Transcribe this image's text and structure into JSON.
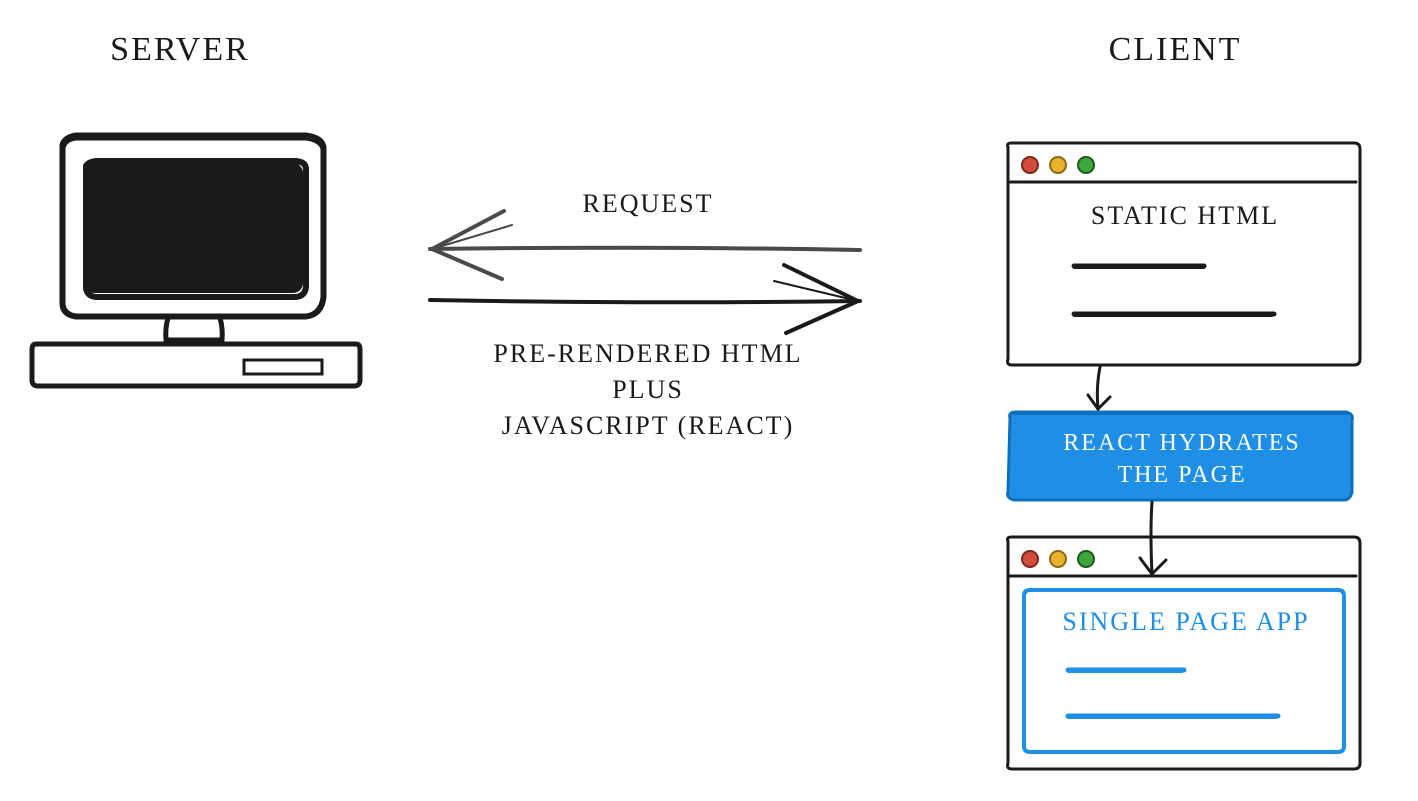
{
  "labels": {
    "server": "SERVER",
    "client": "CLIENT",
    "request": "REQUEST",
    "response1": "PRE-RENDERED HTML",
    "response2": "PLUS",
    "response3": "JAVASCRIPT (REACT)",
    "staticHtml": "STATIC HTML",
    "hydrate1": "REACT HYDRATES",
    "hydrate2": "THE PAGE",
    "spa": "SINGLE PAGE APP"
  },
  "colors": {
    "accent": "#1f8fe6",
    "red": "#d34b3a",
    "yellow": "#e8b32a",
    "green": "#3da63d",
    "ink": "#1a1a1a"
  }
}
